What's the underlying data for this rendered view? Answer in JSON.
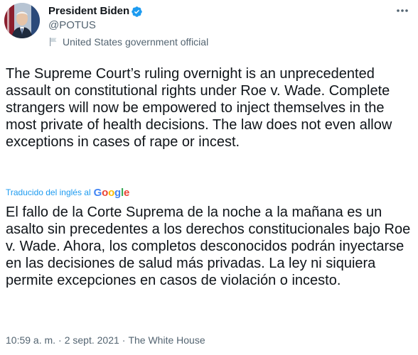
{
  "author": {
    "name": "President Biden",
    "handle": "@POTUS",
    "label": "United States government official",
    "verified": true
  },
  "tweet": {
    "text": "The Supreme Court’s ruling overnight is an unprecedented assault on constitutional rights under Roe v. Wade. Complete strangers will now be empowered to inject themselves in the most private of health decisions. The law does not even allow exceptions in cases of rape or incest.",
    "translation_label": "Traducido del inglés al",
    "translation_provider": "Google",
    "translated_text": "El fallo de la Corte Suprema de la noche a la mañana es un asalto sin precedentes a los derechos constitucionales bajo Roe v. Wade. Ahora, los completos desconocidos podrán inyectarse en las decisiones de salud más privadas. La ley ni siquiera permite excepciones en casos de violación o incesto.",
    "time": "10:59 a. m.",
    "date": "2 sept. 2021",
    "separator": "·",
    "source": "The White House"
  },
  "icons": {
    "verified": "verified-badge-icon",
    "label": "flag-icon",
    "more": "more-options-icon"
  },
  "colors": {
    "text": "#0f1419",
    "secondary": "#536471",
    "accent": "#1d9bf0"
  }
}
